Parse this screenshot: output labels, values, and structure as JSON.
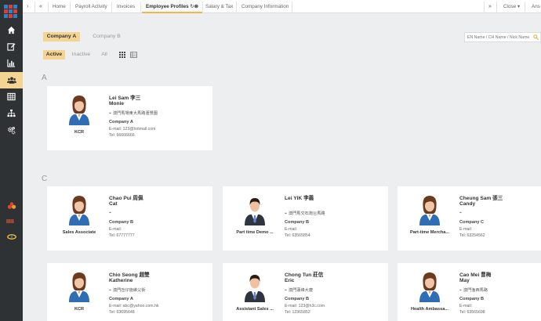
{
  "colors": {
    "accent": "#f5d491",
    "sidebar": "#2f3235",
    "tab_underline": "#f0b84a"
  },
  "topbar": {
    "tabs": [
      {
        "label": "Home"
      },
      {
        "label": "Payroll Activity"
      },
      {
        "label": "Invoices"
      },
      {
        "label": "Employee Profiles"
      },
      {
        "label": "Salary & Tax"
      },
      {
        "label": "Company Information"
      }
    ],
    "close_label": "Close",
    "user_label": "Ans"
  },
  "sidebar": {
    "items": [
      {
        "icon": "home-icon"
      },
      {
        "icon": "edit-icon"
      },
      {
        "icon": "bar-chart-icon"
      },
      {
        "icon": "users-icon"
      },
      {
        "icon": "table-icon"
      },
      {
        "icon": "sitemap-icon"
      },
      {
        "icon": "cogs-icon"
      }
    ],
    "apps": [
      {
        "icon": "app-red-icon"
      },
      {
        "icon": "app-orange-icon"
      },
      {
        "icon": "app-yellow-icon"
      }
    ]
  },
  "filters": {
    "companies": [
      "Company A",
      "Company B"
    ],
    "statuses": [
      "Active",
      "Inactive",
      "All"
    ]
  },
  "search": {
    "placeholder": "EN Name / CH Name / Nick Name"
  },
  "groups": [
    {
      "letter": "A"
    },
    {
      "letter": "C"
    }
  ],
  "employees": [
    {
      "name": "Lei Sam 李三",
      "nick": "Monie",
      "address": "澳門馬場東大馬路滙景園",
      "company": "Company A",
      "email": "E-mail: 123@hotmail.com",
      "tel": "Tel: 66666666",
      "role": "KCR",
      "gender": "female"
    },
    {
      "name": "Chao Pui 周佩",
      "nick": "Cat",
      "address": "",
      "company": "Company B",
      "email": "E-mail:",
      "tel": "Tel: 67777777",
      "role": "Sales Associate",
      "gender": "female"
    },
    {
      "name": "Lei YIK 李義",
      "nick": "",
      "address": "澳門馬交石炮台馬路",
      "company": "Company B",
      "email": "E-mail:",
      "tel": "Tel: 63565854",
      "role": "Part time Demo ...",
      "gender": "male"
    },
    {
      "name": "Cheung Sam 張三",
      "nick": "Candy",
      "address": "",
      "company": "Company C",
      "email": "E-mail:",
      "tel": "Tel: 63254562",
      "role": "Part-time Mercha...",
      "gender": "female"
    },
    {
      "name": "Chio Seong 趙雙",
      "nick": "Katherine",
      "address": "澳門氹仔施維父街",
      "company": "Company A",
      "email": "E-mail: abc@yahoo.com.hk",
      "tel": "Tel: 63695648",
      "role": "KCR",
      "gender": "female"
    },
    {
      "name": "Chong Tun 莊信",
      "nick": "Eric",
      "address": "澳門蓮峰大廈",
      "company": "Company B",
      "email": "E-mail: 123@h3c.com",
      "tel": "Tel: 12365852",
      "role": "Assistant Sales ...",
      "gender": "male"
    },
    {
      "name": "Cao Mei 曹梅",
      "nick": "May",
      "address": "澳門渔西馬路",
      "company": "Company B",
      "email": "E-mail:",
      "tel": "Tel: 63565698",
      "role": "Health Ambassa...",
      "gender": "female"
    }
  ]
}
